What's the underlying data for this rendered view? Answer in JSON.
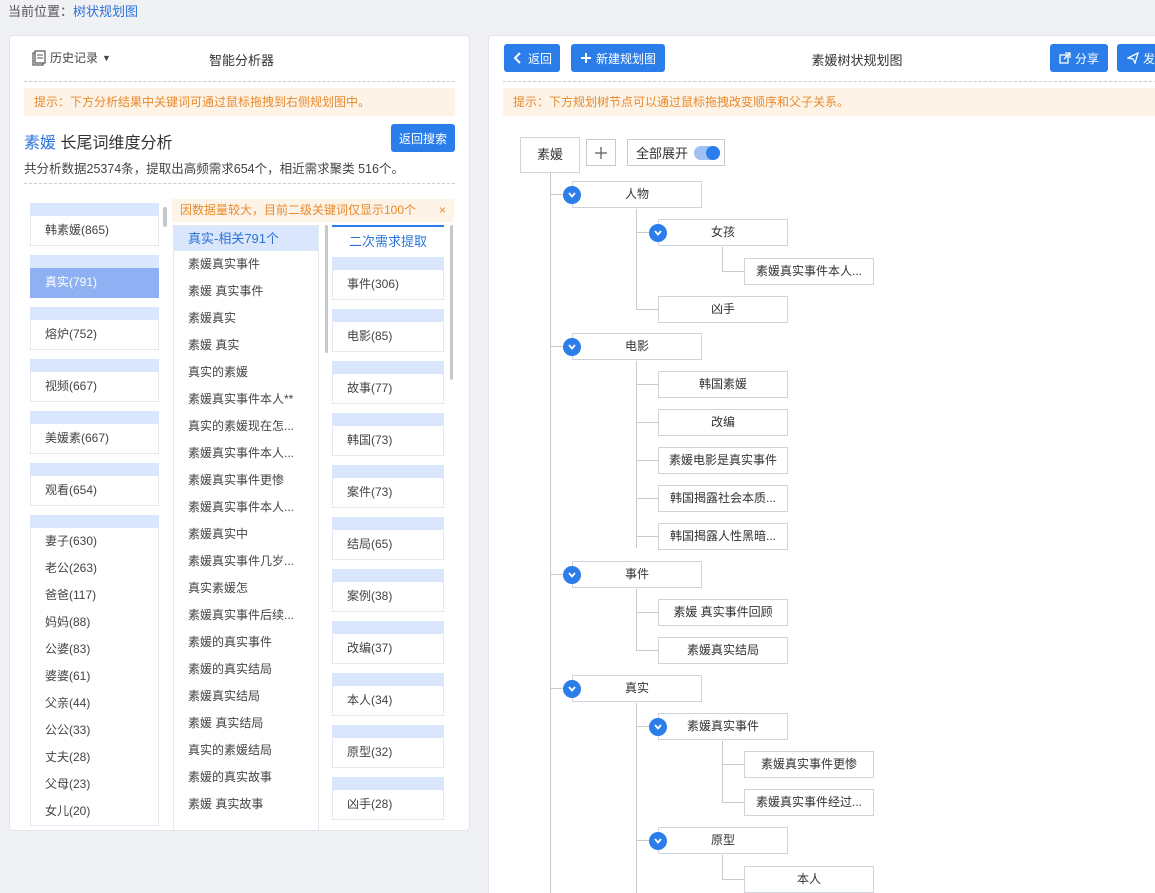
{
  "breadcrumb": {
    "label": "当前位置：",
    "link": "树状规划图"
  },
  "left": {
    "history_label": "历史记录",
    "title": "智能分析器",
    "tip": "提示：下方分析结果中关键词可通过鼠标拖拽到右侧规划图中。",
    "keyword": "素媛",
    "analysis_suffix": " 长尾词维度分析",
    "summary": "共分析数据25374条，提取出高频需求654个，相近需求聚类 516个。",
    "back_search": "返回搜索",
    "notice": "因数据量较大，目前二级关键词仅显示100个",
    "notice_close": "×",
    "col1_groups": [
      {
        "label": "韩素媛(865)",
        "active": false
      },
      {
        "label": "真实(791)",
        "active": true
      },
      {
        "label": "熔炉(752)",
        "active": false
      },
      {
        "label": "视频(667)",
        "active": false
      },
      {
        "label": "美媛素(667)",
        "active": false
      },
      {
        "label": "观看(654)",
        "active": false
      }
    ],
    "col1_list": [
      "妻子(630)",
      "老公(263)",
      "爸爸(117)",
      "妈妈(88)",
      "公婆(83)",
      "婆婆(61)",
      "父亲(44)",
      "公公(33)",
      "丈夫(28)",
      "父母(23)",
      "女儿(20)"
    ],
    "col2_header": "真实-相关791个",
    "col2_items": [
      "素媛真实事件",
      "素媛 真实事件",
      "素媛真实",
      "素媛 真实",
      "真实的素媛",
      "素媛真实事件本人**",
      "真实的素媛现在怎...",
      "素媛真实事件本人...",
      "素媛真实事件更惨",
      "素媛真实事件本人...",
      "素媛真实中",
      "素媛真实事件几岁...",
      "真实素媛怎",
      "素媛真实事件后续...",
      "素媛的真实事件",
      "素媛的真实结局",
      "素媛真实结局",
      "素媛 真实结局",
      "真实的素媛结局",
      "素媛的真实故事",
      "素媛 真实故事"
    ],
    "col3_header": "二次需求提取",
    "col3_items": [
      "事件(306)",
      "电影(85)",
      "故事(77)",
      "韩国(73)",
      "案件(73)",
      "结局(65)",
      "案例(38)",
      "改编(37)",
      "本人(34)",
      "原型(32)",
      "凶手(28)"
    ]
  },
  "right": {
    "back": "返回",
    "new_map": "新建规划图",
    "title": "素媛树状规划图",
    "share": "分享",
    "publish": "发布",
    "tip": "提示：下方规划树节点可以通过鼠标拖拽改变顺序和父子关系。",
    "expand_all": "全部展开",
    "root": "素媛",
    "nodes": {
      "renwu": "人物",
      "nvhai": "女孩",
      "nvhai_1": "素媛真实事件本人...",
      "xiongshou": "凶手",
      "dianying": "电影",
      "dy_1": "韩国素媛",
      "dy_2": "改编",
      "dy_3": "素媛电影是真实事件",
      "dy_4": "韩国揭露社会本质...",
      "dy_5": "韩国揭露人性黑暗...",
      "shijian": "事件",
      "sj_1": "素媛 真实事件回顾",
      "sj_2": "素媛真实结局",
      "zhenshi": "真实",
      "zs_1": "素媛真实事件",
      "zs_1_1": "素媛真实事件更惨",
      "zs_1_2": "素媛真实事件经过...",
      "yuanxing": "原型",
      "yx_1": "本人"
    }
  }
}
